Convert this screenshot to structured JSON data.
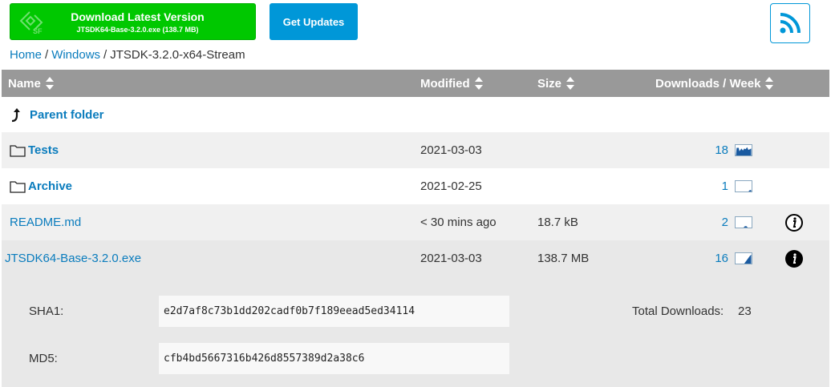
{
  "download_button": {
    "title": "Download Latest Version",
    "subtitle": "JTSDK64-Base-3.2.0.exe (138.7 MB)",
    "logo_text": "SF"
  },
  "updates_button": {
    "label": "Get Updates"
  },
  "rss": {
    "icon": "rss-icon"
  },
  "breadcrumb": {
    "items": [
      "Home",
      "Windows"
    ],
    "separator": "/",
    "current": "JTSDK-3.2.0-x64-Stream"
  },
  "table": {
    "headers": {
      "name": "Name",
      "modified": "Modified",
      "size": "Size",
      "downloads": "Downloads / Week"
    },
    "parent": {
      "label": "Parent folder",
      "icon": "up-arrow-icon"
    },
    "rows": [
      {
        "name": "Tests",
        "type": "folder",
        "modified": "2021-03-03",
        "size": "",
        "downloads": "18"
      },
      {
        "name": "Archive",
        "type": "folder",
        "modified": "2021-02-25",
        "size": "",
        "downloads": "1"
      },
      {
        "name": "README.md",
        "type": "file",
        "modified": "< 30 mins ago",
        "size": "18.7 kB",
        "downloads": "2"
      },
      {
        "name": "JTSDK64-Base-3.2.0.exe",
        "type": "file",
        "modified": "2021-03-03",
        "size": "138.7 MB",
        "downloads": "16"
      }
    ]
  },
  "details": {
    "sha1_label": "SHA1:",
    "sha1": "e2d7af8c73b1dd202cadf0b7f189eead5ed34114",
    "md5_label": "MD5:",
    "md5": "cfb4bd5667316b426d8557389d2a38c6",
    "total_label": "Total Downloads:",
    "total": "23"
  },
  "colors": {
    "download_green": "#00c800",
    "accent_blue": "#0097d8",
    "link_blue": "#0a7cbd",
    "header_gray": "#999999"
  }
}
